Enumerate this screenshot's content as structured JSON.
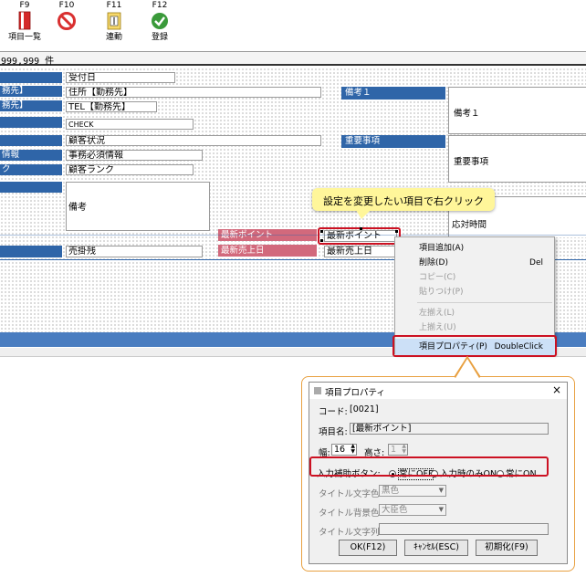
{
  "toolbar": {
    "items": [
      {
        "key": "F9",
        "label": "項目一覧",
        "icon": "list-book-icon"
      },
      {
        "key": "F10",
        "label": "",
        "icon": "no-entry-icon"
      },
      {
        "key": "F11",
        "label": "連動",
        "icon": "link-doc-icon"
      },
      {
        "key": "F12",
        "label": "登録",
        "icon": "check-circle-icon"
      }
    ]
  },
  "count_text": "999,999 件",
  "form": {
    "left_labels": [
      "務先】",
      "務先】",
      "",
      "",
      "情報",
      "ク"
    ],
    "fields": {
      "reception_date": "受付日",
      "address": "住所【勤務先】",
      "tel": "TEL【勤務先】",
      "check": "CHECK",
      "customer_status": "顧客状況",
      "required_info": "事務必須情報",
      "customer_rank": "顧客ランク",
      "remarks": "備考",
      "receivable": "売掛残",
      "latest_point": "最新ポイント",
      "latest_sales_date": "最新売上日"
    },
    "right": {
      "remarks1_label": "備考１",
      "remarks1_value": "備考１",
      "important_label": "重要事項",
      "important_value": "重要事項",
      "response_time": "応対時間"
    },
    "red_labels": {
      "latest_point": "最新ポイント",
      "latest_sales_date": "最新売上日"
    }
  },
  "callout": "設定を変更したい項目で右クリック",
  "context_menu": {
    "items": [
      {
        "label": "項目追加(A)",
        "shortcut": "",
        "enabled": true
      },
      {
        "label": "削除(D)",
        "shortcut": "Del",
        "enabled": true
      },
      {
        "label": "コピー(C)",
        "shortcut": "",
        "enabled": false
      },
      {
        "label": "貼りつけ(P)",
        "shortcut": "",
        "enabled": false
      },
      {
        "label": "左揃え(L)",
        "shortcut": "",
        "enabled": false
      },
      {
        "label": "上揃え(U)",
        "shortcut": "",
        "enabled": false
      },
      {
        "label": "項目プロパティ(P)",
        "shortcut": "DoubleClick",
        "enabled": true,
        "highlighted": true
      }
    ]
  },
  "dialog": {
    "title": "項目プロパティ",
    "close": "×",
    "code_label": "コード:",
    "code_value": "[0021]",
    "name_label": "項目名:",
    "name_value": "[最新ポイント]",
    "width_label": "幅:",
    "width_value": "16",
    "height_label": "高さ:",
    "height_value": "1",
    "assist_label": "入力補助ボタン:",
    "assist_options": [
      "常にOFF",
      "入力時のみON",
      "常にON"
    ],
    "assist_selected": 0,
    "title_color_label": "タイトル文字色:",
    "title_color_value": "黒色",
    "title_bg_label": "タイトル背景色:",
    "title_bg_value": "大臣色",
    "title_text_label": "タイトル文字列:",
    "title_text_value": "",
    "buttons": {
      "ok": "OK(F12)",
      "cancel": "ｷｬﾝｾﾙ(ESC)",
      "init": "初期化(F9)"
    }
  },
  "colors": {
    "blue_label": "#2f65a8",
    "red_label": "#d2697c",
    "highlight": "#cc1122",
    "callout_bg": "#fff69a",
    "orange_border": "#e8a040",
    "menu_highlight": "#cce0f7"
  }
}
